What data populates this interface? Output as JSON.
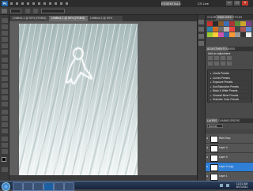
{
  "menu": {
    "logo": "Ps",
    "essentials": "ESSENTIALS",
    "cs_live": "CS Live"
  },
  "documents": {
    "tabs": [
      {
        "label": "Untitled-1 @ 50% (RGB/8)"
      },
      {
        "label": "Untitled-2 @ 50% (RGB/8)"
      },
      {
        "label": "Untitled-3 @ 50%"
      }
    ]
  },
  "right_panel": {
    "top_tabs": [
      "COLOR",
      "SWATCHES",
      "STYLES"
    ],
    "swatch_colors": [
      "#c8322c",
      "#2b2b2b",
      "#8a5c2a",
      "#3d6fb5",
      "#a33",
      "#5a8a3b",
      "#caa62c",
      "#7a3e8c",
      "#2e7fa3",
      "#d46c1c",
      "#6d6d6d",
      "#b7b7b7",
      "#e44",
      "#444",
      "#a55",
      "#58c",
      "#9c3",
      "#fc3",
      "#c5a",
      "#36a",
      "#f93",
      "#999",
      "#333",
      "#eee"
    ],
    "adjust_tabs": [
      "ADJUSTMENTS",
      "MASKS"
    ],
    "adjust_title": "Add an adjustment",
    "presets": [
      "Levels Presets",
      "Curves Presets",
      "Exposure Presets",
      "Hue/Saturation Presets",
      "Black & White Presets",
      "Channel Mixer Presets",
      "Selective Color Presets"
    ],
    "layers_tabs": [
      "LAYERS",
      "CHANNELS",
      "PATHS"
    ],
    "blend_mode": "Normal",
    "layers": [
      {
        "name": "Rain Drop",
        "selected": false
      },
      {
        "name": "Layer 4",
        "selected": false
      },
      {
        "name": "Layer 3",
        "selected": false
      },
      {
        "name": "Layer 2 copy",
        "selected": true
      },
      {
        "name": "Layer 1",
        "selected": false
      }
    ]
  },
  "taskbar": {
    "time": "12:21 AM",
    "date": "9/27/2011"
  }
}
